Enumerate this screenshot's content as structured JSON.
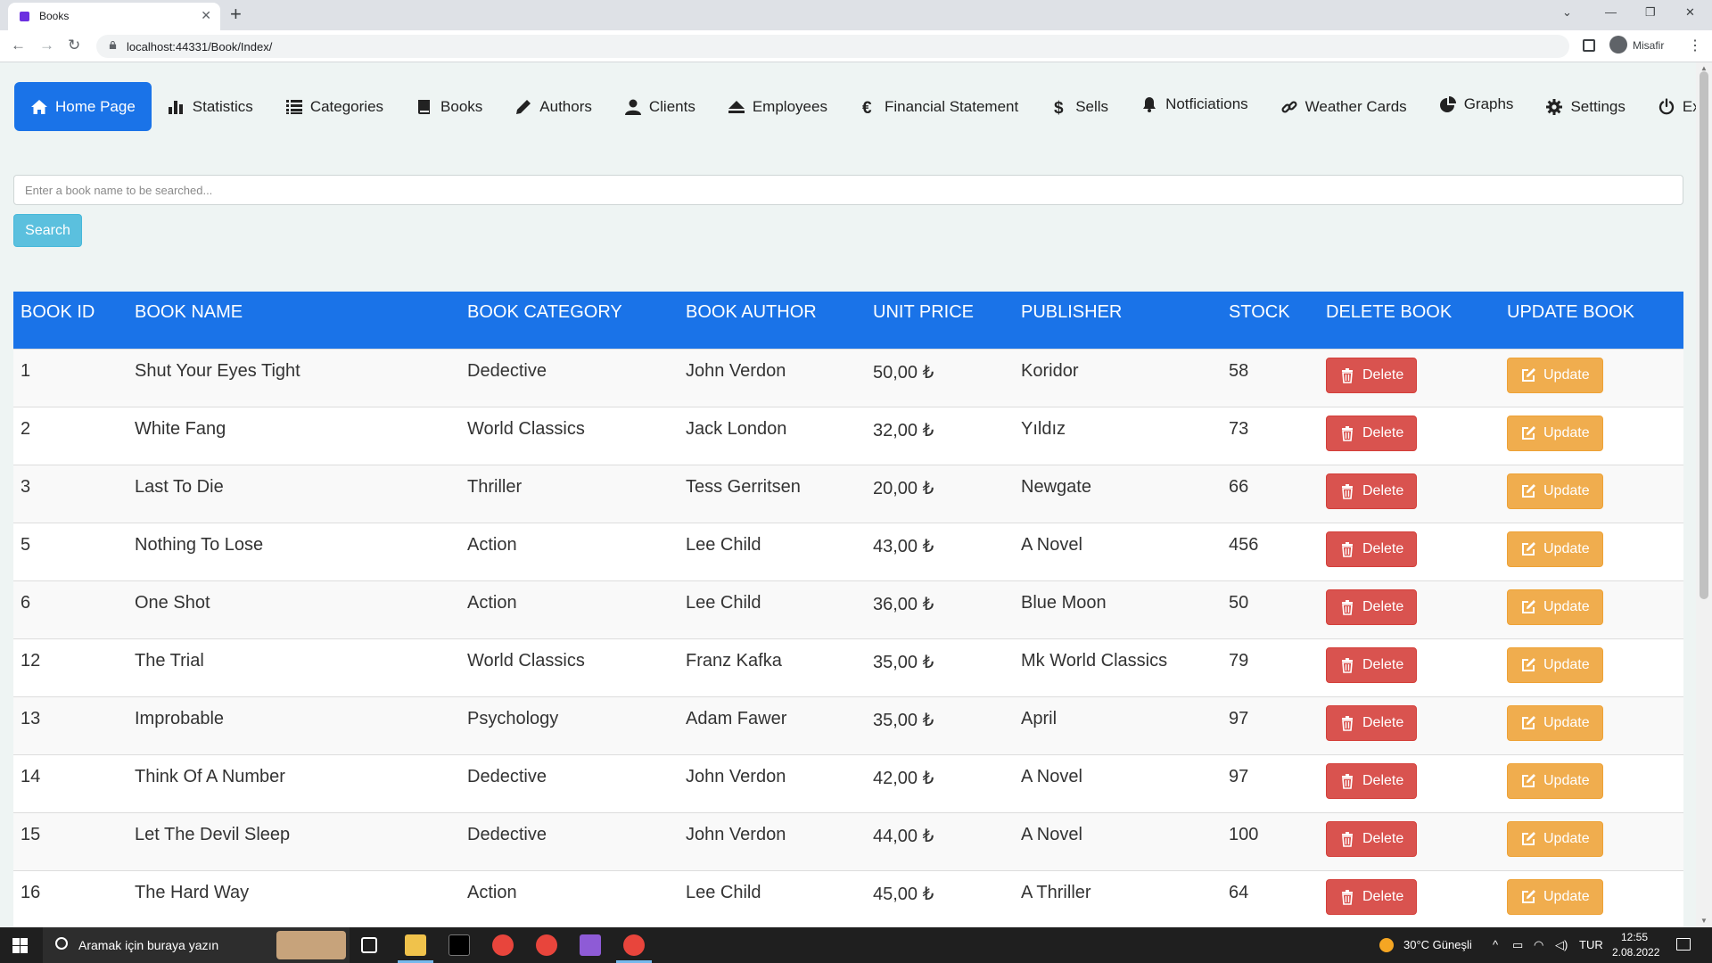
{
  "browser": {
    "tab_title": "Books",
    "url": "localhost:44331/Book/Index/",
    "profile_name": "Misafir"
  },
  "nav": {
    "items": [
      {
        "label": "Home Page",
        "icon": "home-icon",
        "active": true
      },
      {
        "label": "Statistics",
        "icon": "bar-chart-icon"
      },
      {
        "label": "Categories",
        "icon": "list-icon"
      },
      {
        "label": "Books",
        "icon": "book-icon"
      },
      {
        "label": "Authors",
        "icon": "pencil-icon"
      },
      {
        "label": "Clients",
        "icon": "user-icon"
      },
      {
        "label": "Employees",
        "icon": "eject-icon"
      },
      {
        "label": "Financial Statement",
        "icon": "euro-icon"
      },
      {
        "label": "Sells",
        "icon": "dollar-icon"
      },
      {
        "label": "Notficiations",
        "icon": "bell-icon"
      },
      {
        "label": "Weather Cards",
        "icon": "link-icon"
      },
      {
        "label": "Graphs",
        "icon": "pie-chart-icon"
      },
      {
        "label": "Settings",
        "icon": "gear-icon"
      },
      {
        "label": "Exit",
        "icon": "power-icon"
      }
    ]
  },
  "search": {
    "placeholder": "Enter a book name to be searched...",
    "button_label": "Search"
  },
  "table": {
    "headers": [
      "BOOK ID",
      "BOOK NAME",
      "BOOK CATEGORY",
      "BOOK AUTHOR",
      "UNIT PRICE",
      "PUBLISHER",
      "STOCK",
      "DELETE BOOK",
      "UPDATE BOOK"
    ],
    "delete_label": "Delete",
    "update_label": "Update",
    "rows": [
      {
        "id": "1",
        "name": "Shut Your Eyes Tight",
        "category": "Dedective",
        "author": "John Verdon",
        "price": "50,00 ₺",
        "publisher": "Koridor",
        "stock": "58"
      },
      {
        "id": "2",
        "name": "White Fang",
        "category": "World Classics",
        "author": "Jack London",
        "price": "32,00 ₺",
        "publisher": "Yıldız",
        "stock": "73"
      },
      {
        "id": "3",
        "name": "Last To Die",
        "category": "Thriller",
        "author": "Tess Gerritsen",
        "price": "20,00 ₺",
        "publisher": "Newgate",
        "stock": "66"
      },
      {
        "id": "5",
        "name": "Nothing To Lose",
        "category": "Action",
        "author": "Lee Child",
        "price": "43,00 ₺",
        "publisher": "A Novel",
        "stock": "456"
      },
      {
        "id": "6",
        "name": "One Shot",
        "category": "Action",
        "author": "Lee Child",
        "price": "36,00 ₺",
        "publisher": "Blue Moon",
        "stock": "50"
      },
      {
        "id": "12",
        "name": "The Trial",
        "category": "World Classics",
        "author": "Franz Kafka",
        "price": "35,00 ₺",
        "publisher": "Mk World Classics",
        "stock": "79"
      },
      {
        "id": "13",
        "name": "Improbable",
        "category": "Psychology",
        "author": "Adam Fawer",
        "price": "35,00 ₺",
        "publisher": "April",
        "stock": "97"
      },
      {
        "id": "14",
        "name": "Think Of A Number",
        "category": "Dedective",
        "author": "John Verdon",
        "price": "42,00 ₺",
        "publisher": "A Novel",
        "stock": "97"
      },
      {
        "id": "15",
        "name": "Let The Devil Sleep",
        "category": "Dedective",
        "author": "John Verdon",
        "price": "44,00 ₺",
        "publisher": "A Novel",
        "stock": "100"
      },
      {
        "id": "16",
        "name": "The Hard Way",
        "category": "Action",
        "author": "Lee Child",
        "price": "45,00 ₺",
        "publisher": "A Thriller",
        "stock": "64"
      }
    ]
  },
  "taskbar": {
    "search_text": "Aramak için buraya yazın",
    "weather": "30°C  Güneşli",
    "language": "TUR",
    "time": "12:55",
    "date": "2.08.2022"
  },
  "colors": {
    "primary": "#1a73e8",
    "info": "#5bc0de",
    "danger": "#d9534f",
    "warning": "#f0ad4e",
    "page_background": "#eef4f3"
  }
}
